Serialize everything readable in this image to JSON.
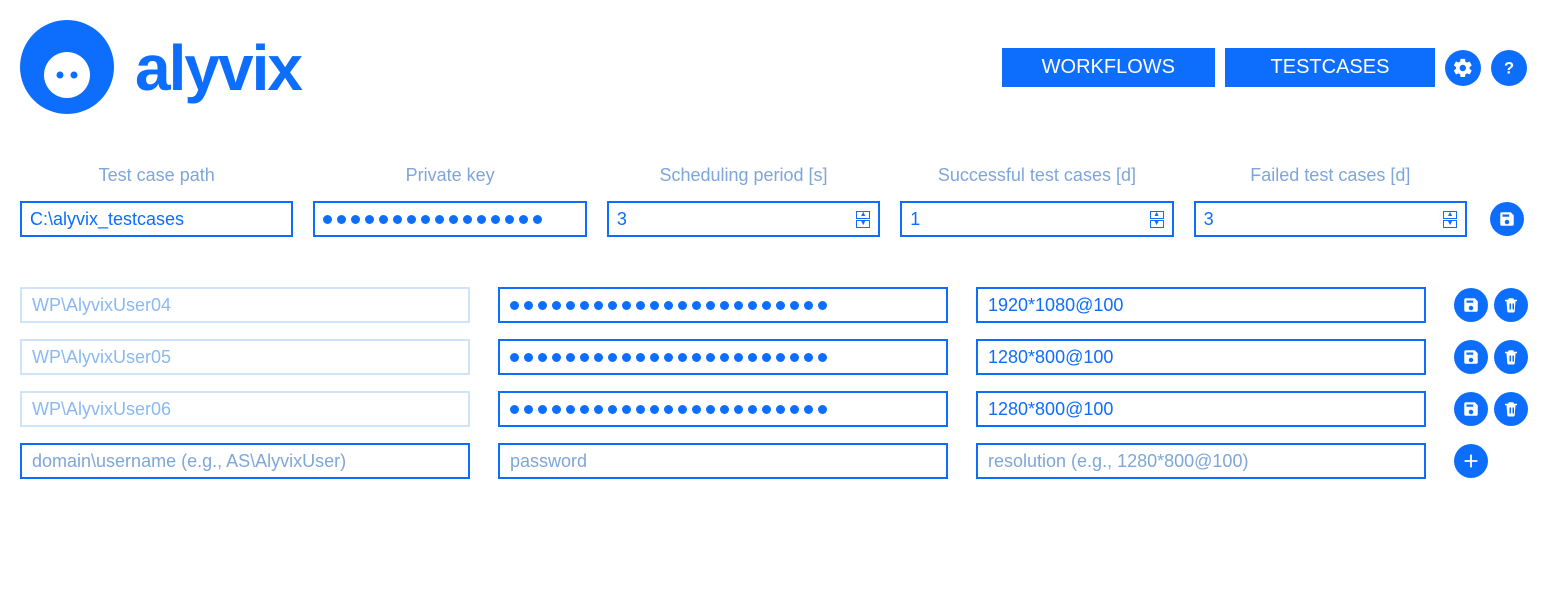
{
  "header": {
    "brand": "alyvix",
    "nav": {
      "workflows": "WORKFLOWS",
      "testcases": "TESTCASES"
    }
  },
  "config": {
    "labels": {
      "path": "Test case path",
      "key": "Private key",
      "period": "Scheduling period [s]",
      "success": "Successful test cases [d]",
      "failed": "Failed test cases [d]"
    },
    "values": {
      "path": "C:\\alyvix_testcases",
      "key_mask": "••••••••••••••••",
      "period": "3",
      "success": "1",
      "failed": "3"
    }
  },
  "users": [
    {
      "username": "WP\\AlyvixUser04",
      "password_len": 23,
      "resolution": "1920*1080@100"
    },
    {
      "username": "WP\\AlyvixUser05",
      "password_len": 23,
      "resolution": "1280*800@100"
    },
    {
      "username": "WP\\AlyvixUser06",
      "password_len": 23,
      "resolution": "1280*800@100"
    }
  ],
  "new_user": {
    "username_ph": "domain\\username (e.g., AS\\AlyvixUser)",
    "password_ph": "password",
    "resolution_ph": "resolution (e.g., 1280*800@100)"
  }
}
